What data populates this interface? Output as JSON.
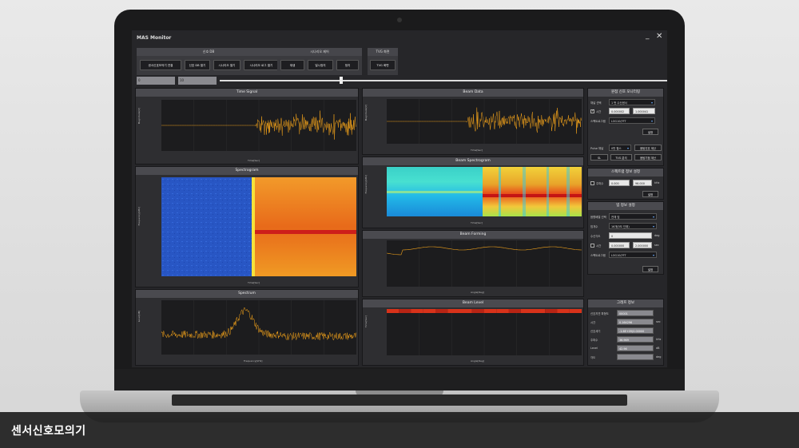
{
  "window": {
    "title": "MAS Monitor",
    "min": "_",
    "close": "✕"
  },
  "toolbar": {
    "groups": [
      {
        "label": "신호 DB",
        "buttons": [
          "센서신호모의기 연결",
          "신호 DB 열기",
          "시나리오 열기",
          "시나리오 로그 열기"
        ]
      },
      {
        "label": "시나리오 제어",
        "buttons": [
          "재생",
          "일시정지",
          "정지"
        ]
      },
      {
        "label": "TVG 화면",
        "buttons": [
          "TVG 화면"
        ]
      }
    ]
  },
  "range": {
    "start": "0",
    "end": "10"
  },
  "panels": {
    "time_signal": {
      "title": "Time Signal",
      "ylabel": "Magnitude[V]",
      "xlabel": "Time[Sec]",
      "yticks": [
        "46593490",
        "23296745",
        "0",
        "-46593490",
        "-46593490"
      ],
      "xticks": [
        "0.0004602",
        "0.66440283",
        "0.83407968",
        "0.64531640",
        "0.88575791",
        "0.88516405",
        "1.0054478"
      ]
    },
    "spectrogram": {
      "title": "Spectrogram",
      "ylabel": "Frequency[kHz]",
      "xlabel": "Time[Sec]",
      "yticks": [
        "60",
        "72",
        "48",
        "24",
        "0"
      ],
      "xticks": [
        "0",
        "0.33333333",
        "0.66666667",
        "1",
        "1.33333333",
        "1.66666667",
        "2"
      ]
    },
    "spectrum": {
      "title": "Spectrum",
      "ylabel": "Level[dB]",
      "xlabel": "Frequency[kHz]",
      "yticks": [
        "136.8",
        "102.60",
        "68.4",
        "34.20",
        "0"
      ],
      "xticks": [
        "0.00",
        "16.00",
        "32.00",
        "48.00",
        "64.00",
        "80.00",
        "96.00"
      ]
    },
    "beam_data": {
      "title": "Beam Data",
      "ylabel": "Magnitude[V]",
      "xlabel": "Time[Sec]",
      "yticks": [
        "1.66733476.4",
        "861688736.2",
        "0",
        "861688736.2",
        "1.66733476.4"
      ],
      "xticks": [
        "0",
        "0.33333333",
        "0.66666667",
        "1",
        "1.33333333",
        "1.66666667",
        "2"
      ]
    },
    "beam_spectrogram": {
      "title": "Beam Spectrogram",
      "ylabel": "Frequency[kHz]",
      "xlabel": "Time[Sec]",
      "yticks": [
        "96",
        "72",
        "48",
        "24",
        "0"
      ],
      "xticks": [
        "0",
        "0.33333333",
        "0.66666667",
        "1",
        "1.33333333",
        "1.66666667",
        "2"
      ]
    },
    "beam_forming": {
      "title": "Beam Forming",
      "ylabel": "",
      "xlabel": "Angle[Deg]",
      "yticks": [
        "1",
        "0.75",
        "0.5",
        "0.25",
        "0"
      ],
      "xticks": [
        "-45",
        "-30",
        "-15",
        "0",
        "15",
        "30",
        "45"
      ]
    },
    "beam_level": {
      "title": "Beam Level",
      "ylabel": "Time[Sec]",
      "xlabel": "Angle[Deg]",
      "yticks": [
        "0",
        "15",
        "30",
        "45",
        "60"
      ],
      "xticks": [
        "-45",
        "-30",
        "-15",
        "0",
        "15",
        "30",
        "45"
      ]
    }
  },
  "side": {
    "sensor_settings": {
      "title": "원점 신호 모니터링",
      "channel_label": "채널 선택",
      "channel_value": "1 번 수신센서",
      "time_label": "시간",
      "time_from": "0.000002",
      "time_to": "1.000041",
      "scale_label": "스펙트로그램",
      "scale_value": "LOG10(FFT",
      "apply": "설정",
      "pulse_label": "Pulse 채널",
      "pulse_value": "0번 펄스",
      "pulse_button": "음탐신호 계산",
      "btn_sl": "SL",
      "btn_tvg": "TVG 분석",
      "btn_calc": "음탐기점 계산"
    },
    "spectrum_settings": {
      "title": "스펙트럼 정보 설정",
      "freq_label": "주파수",
      "freq_from": "0.000",
      "freq_to": "96.000",
      "unit": "kHz",
      "apply": "설정"
    },
    "beam_settings": {
      "title": "빔 정보 설정",
      "array_label": "음향배열 선택",
      "array_value": "전체 빔",
      "num_label": "빔개수",
      "num_value": "16개(5도 단위)",
      "angle_label": "수신각도",
      "angle_value": "0",
      "angle_unit": "deg",
      "time_label": "시간",
      "time_from": "0.000000",
      "time_to": "2.000000",
      "time_unit": "sec",
      "scale_label": "스펙트로그램",
      "scale_value": "LOG10(FFT",
      "apply": "설정"
    },
    "graph_info": {
      "title": "그래프 정보",
      "rows": [
        {
          "label": "신호지연 파형도",
          "value": "00001",
          "unit": ""
        },
        {
          "label": "시간",
          "value": "0.164296",
          "unit": "sec"
        },
        {
          "label": "신호세기",
          "value": "-1.6E+09(0.00000",
          "unit": ""
        },
        {
          "label": "주파수",
          "value": "36.969",
          "unit": "kHz"
        },
        {
          "label": "Level",
          "value": "42.96",
          "unit": "dB"
        },
        {
          "label": "각도",
          "value": "",
          "unit": "deg"
        }
      ]
    }
  },
  "caption": "센서신호모의기",
  "colors": {
    "signal": "#f2a21a",
    "spectro_hot": "#e8401a",
    "spectro_cold": "#2a55c8",
    "beam_level": "#d8321a"
  }
}
